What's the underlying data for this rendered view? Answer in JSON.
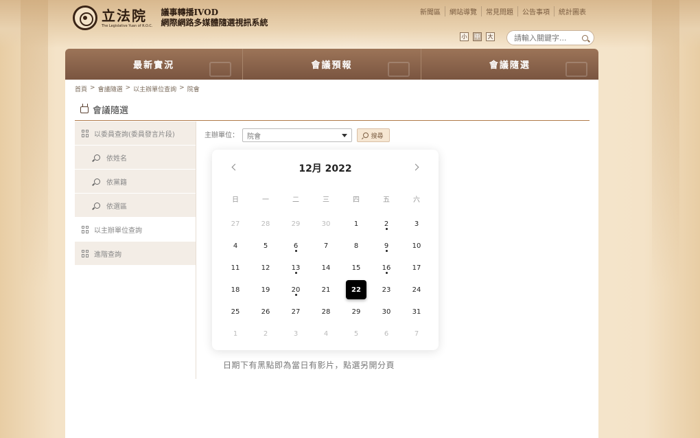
{
  "header": {
    "logo_text": "立法院",
    "logo_subtitle": "The Legislative Yuan of R.O.C.",
    "system_title_line1": "議事轉播IVOD",
    "system_title_line2": "網際網路多媒體隨選視訊系統",
    "top_links": [
      "新聞區",
      "網站導覽",
      "常見問題",
      "公告事項",
      "統計圖表"
    ],
    "font_sizes": [
      "小",
      "中",
      "大"
    ],
    "search_placeholder": "請輸入關鍵字..."
  },
  "nav": {
    "items": [
      "最新實況",
      "會議預報",
      "會議隨選"
    ]
  },
  "breadcrumb": [
    "首頁",
    ">",
    "會議隨選",
    ">",
    "以主辦單位查詢",
    ">",
    "院會"
  ],
  "page_title": "會議隨選",
  "sidebar": {
    "items": [
      {
        "label": "以委員查詢(委員發言片段)"
      },
      {
        "label": "依姓名"
      },
      {
        "label": "依黨籍"
      },
      {
        "label": "依選區"
      },
      {
        "label": "以主辦單位查詢"
      },
      {
        "label": "進階查詢"
      }
    ]
  },
  "filter": {
    "unit_label": "主辦單位：",
    "unit_value": "院會",
    "search_button": "搜尋"
  },
  "calendar": {
    "title": "12月 2022",
    "weekdays": [
      "日",
      "一",
      "二",
      "三",
      "四",
      "五",
      "六"
    ],
    "days": [
      {
        "d": "27",
        "other": true
      },
      {
        "d": "28",
        "other": true
      },
      {
        "d": "29",
        "other": true
      },
      {
        "d": "30",
        "other": true
      },
      {
        "d": "1"
      },
      {
        "d": "2",
        "dot": true
      },
      {
        "d": "3"
      },
      {
        "d": "4"
      },
      {
        "d": "5"
      },
      {
        "d": "6",
        "dot": true
      },
      {
        "d": "7"
      },
      {
        "d": "8"
      },
      {
        "d": "9",
        "dot": true
      },
      {
        "d": "10"
      },
      {
        "d": "11"
      },
      {
        "d": "12"
      },
      {
        "d": "13",
        "dot": true
      },
      {
        "d": "14"
      },
      {
        "d": "15"
      },
      {
        "d": "16",
        "dot": true
      },
      {
        "d": "17"
      },
      {
        "d": "18"
      },
      {
        "d": "19"
      },
      {
        "d": "20",
        "dot": true
      },
      {
        "d": "21"
      },
      {
        "d": "22",
        "selected": true
      },
      {
        "d": "23"
      },
      {
        "d": "24"
      },
      {
        "d": "25"
      },
      {
        "d": "26"
      },
      {
        "d": "27"
      },
      {
        "d": "28"
      },
      {
        "d": "29"
      },
      {
        "d": "30"
      },
      {
        "d": "31"
      },
      {
        "d": "1",
        "other": true
      },
      {
        "d": "2",
        "other": true
      },
      {
        "d": "3",
        "other": true
      },
      {
        "d": "4",
        "other": true
      },
      {
        "d": "5",
        "other": true
      },
      {
        "d": "6",
        "other": true
      },
      {
        "d": "7",
        "other": true
      }
    ]
  },
  "hint": "日期下有黑點即為當日有影片，點選另開分頁",
  "colors": {
    "nav_bg": "#8a6249",
    "accent_rule": "#b07a48",
    "selected_day": "#000000"
  }
}
